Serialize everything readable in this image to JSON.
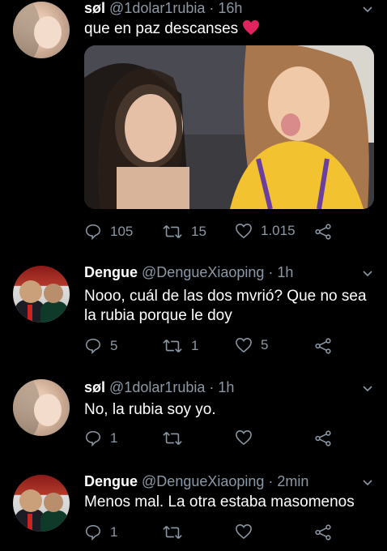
{
  "tweets": [
    {
      "name": "søl",
      "handle": "@1dolar1rubia",
      "time": "16h",
      "text": "que en paz descanses",
      "replies": "105",
      "retweets": "15",
      "likes": "1.015"
    },
    {
      "name": "Dengue",
      "handle": "@DengueXiaoping",
      "time": "1h",
      "text": "Nooo, cuál de las dos mvrió? Que no sea la rubia porque le doy",
      "replies": "5",
      "retweets": "1",
      "likes": "5"
    },
    {
      "name": "søl",
      "handle": "@1dolar1rubia",
      "time": "1h",
      "text": "No, la rubia soy yo.",
      "replies": "1",
      "retweets": "",
      "likes": ""
    },
    {
      "name": "Dengue",
      "handle": "@DengueXiaoping",
      "time": "2min",
      "text": "Menos mal. La otra estaba masomenos",
      "replies": "1",
      "retweets": "",
      "likes": ""
    }
  ],
  "colors": {
    "background": "#000000",
    "muted": "#8b98a5",
    "heart": "#e0245e"
  },
  "icons": [
    "reply-icon",
    "retweet-icon",
    "like-icon",
    "share-icon",
    "chevron-down-icon",
    "heart-emoji-icon"
  ]
}
